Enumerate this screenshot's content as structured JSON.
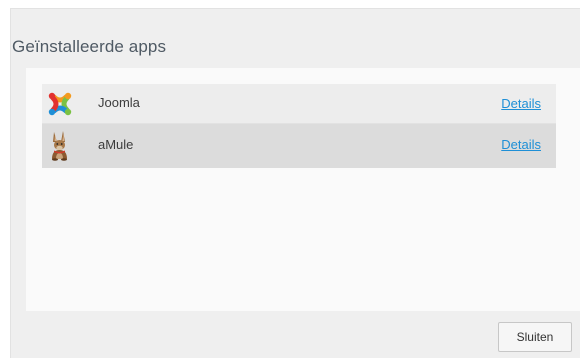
{
  "dialog": {
    "title": "Geïnstalleerde apps",
    "close_label": "Sluiten"
  },
  "apps": [
    {
      "name": "Joomla",
      "details_label": "Details",
      "icon": "joomla-logo-icon",
      "selected": false
    },
    {
      "name": "aMule",
      "details_label": "Details",
      "icon": "amule-mule-icon",
      "selected": true
    }
  ]
}
